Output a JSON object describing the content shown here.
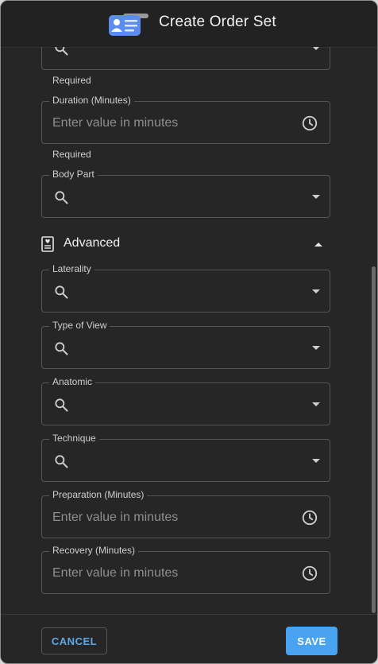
{
  "dialog": {
    "title": "Create Order Set"
  },
  "fields": {
    "top_select": {
      "helper": "Required"
    },
    "duration": {
      "label": "Duration (Minutes)",
      "placeholder": "Enter value in minutes",
      "helper": "Required"
    },
    "body_part": {
      "label": "Body Part"
    },
    "advanced": {
      "title": "Advanced"
    },
    "laterality": {
      "label": "Laterality"
    },
    "type_of_view": {
      "label": "Type of View"
    },
    "anatomic": {
      "label": "Anatomic"
    },
    "technique": {
      "label": "Technique"
    },
    "preparation": {
      "label": "Preparation (Minutes)",
      "placeholder": "Enter value in minutes"
    },
    "recovery": {
      "label": "Recovery (Minutes)",
      "placeholder": "Enter value in minutes"
    }
  },
  "footer": {
    "cancel_label": "CANCEL",
    "save_label": "SAVE"
  },
  "colors": {
    "accent": "#4aa3f0",
    "background": "#262626",
    "border": "#555555"
  }
}
